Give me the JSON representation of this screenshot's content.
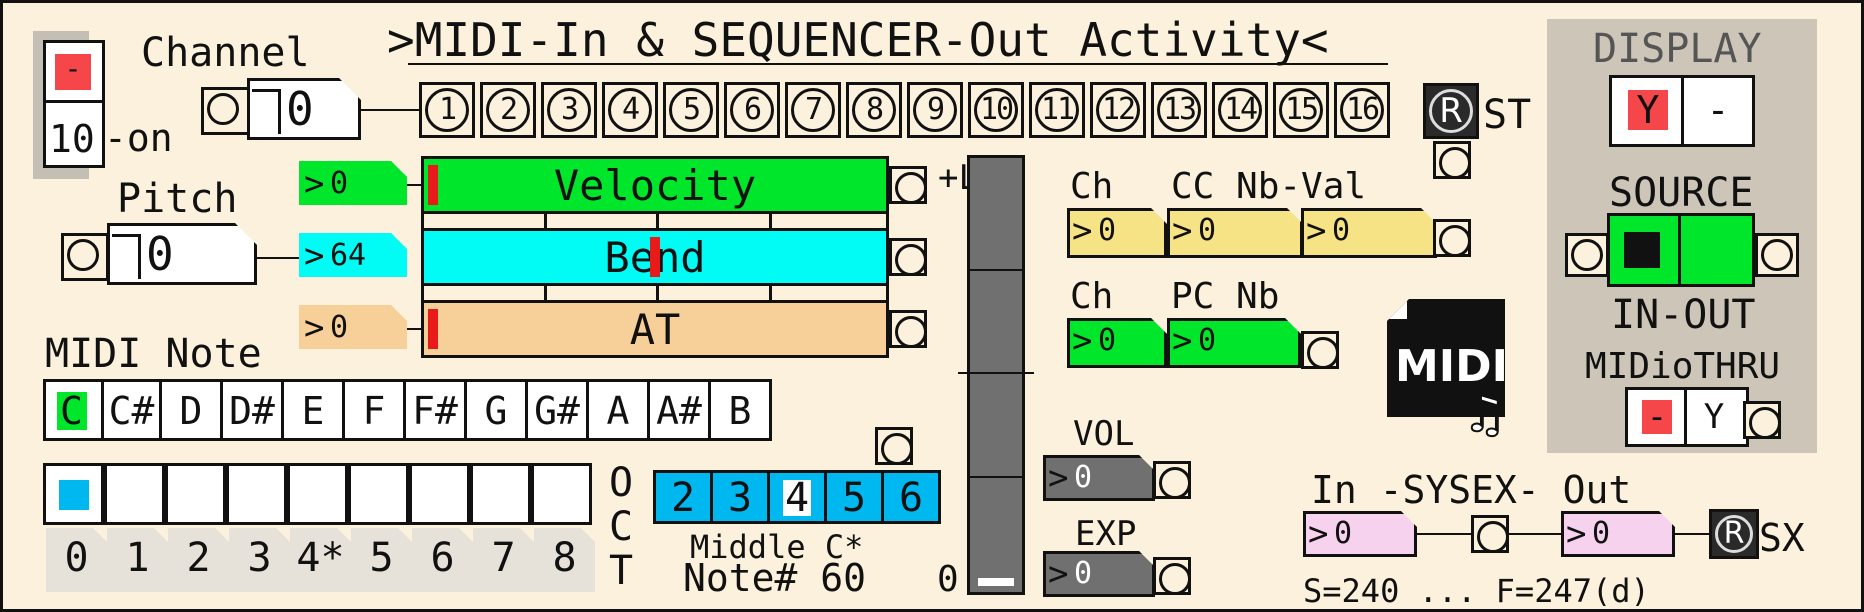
{
  "title": ">MIDI-In & SEQUENCER-Out Activity<",
  "channel": {
    "label": "Channel",
    "value": "0",
    "buttons": [
      "1",
      "2",
      "3",
      "4",
      "5",
      "6",
      "7",
      "8",
      "9",
      "10",
      "11",
      "12",
      "13",
      "14",
      "15",
      "16"
    ],
    "toggle_top": "-",
    "toggle_bottom": "10",
    "toggle_suffix": "-on",
    "st_button": "R",
    "st_label": "ST"
  },
  "pitch": {
    "label": "Pitch",
    "value": "0"
  },
  "bars": {
    "velocity": {
      "label": "Velocity",
      "value": "0",
      "level": 0.0,
      "color": "#00e62a"
    },
    "bend": {
      "label": "Bend",
      "value": "64",
      "level": 0.5,
      "color": "#00fcf4"
    },
    "at": {
      "label": "AT",
      "value": "0",
      "level": 0.0,
      "color": "#f7cf98"
    }
  },
  "midi_note": {
    "label": "MIDI Note",
    "keys": [
      "C",
      "C#",
      "D",
      "D#",
      "E",
      "F",
      "F#",
      "G",
      "G#",
      "A",
      "A#",
      "B"
    ],
    "active_key": "C"
  },
  "octaves": {
    "labels": [
      "0",
      "1",
      "2",
      "3",
      "4*",
      "5",
      "6",
      "7",
      "8"
    ],
    "active": "0",
    "side_label": [
      "O",
      "C",
      "T"
    ]
  },
  "middle_c": {
    "options": [
      "2",
      "3",
      "4",
      "5",
      "6"
    ],
    "selected": "4",
    "label": "Middle C*",
    "note_label": "Note# 60"
  },
  "level": {
    "plus_label": "+LVL",
    "zero_label": "0",
    "value": 0.0
  },
  "cc": {
    "ch_label": "Ch",
    "nb_label": "CC Nb-Val",
    "ch": "0",
    "nb": "0",
    "val": "0"
  },
  "pc": {
    "ch_label": "Ch",
    "nb_label": "PC Nb",
    "ch": "0",
    "nb": "0"
  },
  "vol": {
    "label": "VOL",
    "value": "0"
  },
  "exp": {
    "label": "EXP",
    "value": "0"
  },
  "logo": {
    "text": "MIDI",
    "icon": "music-note-icon"
  },
  "sysex": {
    "label": "In -SYSEX- Out",
    "in_value": "0",
    "out_value": "0",
    "button": "R",
    "button_label": "SX",
    "range_label": "S=240 ... F=247(d)"
  },
  "display": {
    "label": "DISPLAY",
    "options": [
      "Y",
      "-"
    ],
    "selected": "Y",
    "source_label": "SOURCE",
    "io_label": "IN-OUT",
    "thru_label": "MIDioTHRU",
    "thru_options": [
      "-",
      "Y"
    ],
    "thru_selected": "-"
  },
  "colors": {
    "background": "#fbf1dc",
    "panel": "#cdc6b8",
    "active_red": "#f5464a",
    "green": "#00e62a",
    "cyan": "#00fcf4",
    "blue": "#00b8f0",
    "yellow": "#f5e385",
    "pink": "#f7d2ef",
    "grey": "#707070"
  }
}
